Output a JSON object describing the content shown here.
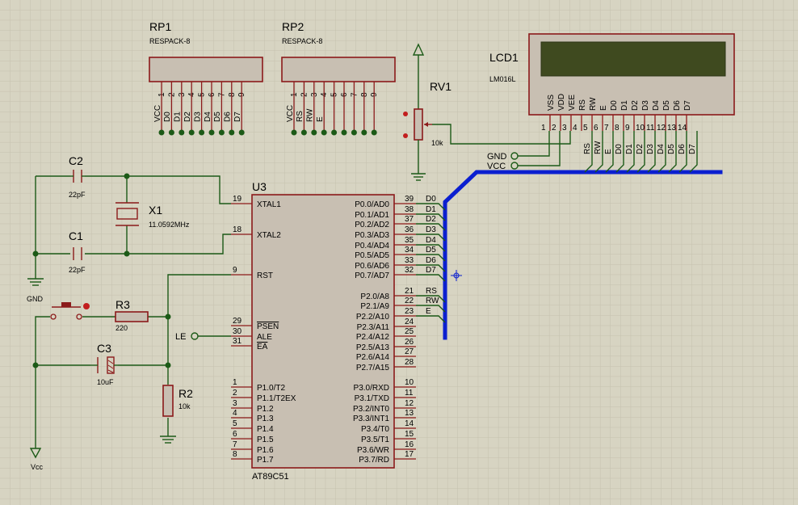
{
  "rp1": {
    "ref": "RP1",
    "value": "RESPACK-8",
    "pins": [
      "VCC",
      "1",
      "D0",
      "2",
      "D1",
      "3",
      "D2",
      "4",
      "D3",
      "5",
      "D4",
      "6",
      "D5",
      "7",
      "D6",
      "8",
      "D7",
      "9"
    ]
  },
  "rp2": {
    "ref": "RP2",
    "value": "RESPACK-8",
    "pins": [
      "VCC",
      "1",
      "RS",
      "2",
      "RW",
      "3",
      "E",
      "4",
      "5",
      "6",
      "7",
      "8",
      "9"
    ]
  },
  "rv1": {
    "ref": "RV1",
    "value": "10k"
  },
  "lcd": {
    "ref": "LCD1",
    "value": "LM016L",
    "pins": [
      "VSS",
      "VDD",
      "VEE",
      "RS",
      "RW",
      "E",
      "D0",
      "D1",
      "D2",
      "D3",
      "D4",
      "D5",
      "D6",
      "D7"
    ],
    "pin_numbers": [
      "1",
      "2",
      "3",
      "4",
      "5",
      "6",
      "7",
      "8",
      "9",
      "10",
      "11",
      "12",
      "13",
      "14"
    ],
    "bus_labels": [
      "RS",
      "RW",
      "E",
      "D0",
      "D1",
      "D2",
      "D3",
      "D4",
      "D5",
      "D6",
      "D7"
    ]
  },
  "terminals": {
    "gnd_right": "GND",
    "vcc_right": "VCC",
    "gnd_left": "GND",
    "vcc_left": "Vcc",
    "le": "LE"
  },
  "c1": {
    "ref": "C1",
    "value": "22pF"
  },
  "c2": {
    "ref": "C2",
    "value": "22pF"
  },
  "c3": {
    "ref": "C3",
    "value": "10uF"
  },
  "x1": {
    "ref": "X1",
    "value": "11.0592MHz"
  },
  "r2": {
    "ref": "R2",
    "value": "10k"
  },
  "r3": {
    "ref": "R3",
    "value": "220"
  },
  "u3": {
    "ref": "U3",
    "part": "AT89C51",
    "left_pins": [
      {
        "num": "19",
        "name": "XTAL1"
      },
      {
        "num": "18",
        "name": "XTAL2"
      },
      {
        "num": "9",
        "name": "RST"
      },
      {
        "num": "29",
        "name": "PSEN"
      },
      {
        "num": "30",
        "name": "ALE"
      },
      {
        "num": "31",
        "name": "EA"
      },
      {
        "num": "1",
        "name": "P1.0/T2"
      },
      {
        "num": "2",
        "name": "P1.1/T2EX"
      },
      {
        "num": "3",
        "name": "P1.2"
      },
      {
        "num": "4",
        "name": "P1.3"
      },
      {
        "num": "5",
        "name": "P1.4"
      },
      {
        "num": "6",
        "name": "P1.5"
      },
      {
        "num": "7",
        "name": "P1.6"
      },
      {
        "num": "8",
        "name": "P1.7"
      }
    ],
    "right_pins": [
      {
        "num": "39",
        "name": "P0.0/AD0",
        "net": "D0"
      },
      {
        "num": "38",
        "name": "P0.1/AD1",
        "net": "D1"
      },
      {
        "num": "37",
        "name": "P0.2/AD2",
        "net": "D2"
      },
      {
        "num": "36",
        "name": "P0.3/AD3",
        "net": "D3"
      },
      {
        "num": "35",
        "name": "P0.4/AD4",
        "net": "D4"
      },
      {
        "num": "34",
        "name": "P0.5/AD5",
        "net": "D5"
      },
      {
        "num": "33",
        "name": "P0.6/AD6",
        "net": "D6"
      },
      {
        "num": "32",
        "name": "P0.7/AD7",
        "net": "D7"
      },
      {
        "num": "21",
        "name": "P2.0/A8",
        "net": "RS"
      },
      {
        "num": "22",
        "name": "P2.1/A9",
        "net": "RW"
      },
      {
        "num": "23",
        "name": "P2.2/A10",
        "net": "E"
      },
      {
        "num": "24",
        "name": "P2.3/A11",
        "net": ""
      },
      {
        "num": "25",
        "name": "P2.4/A12",
        "net": ""
      },
      {
        "num": "26",
        "name": "P2.5/A13",
        "net": ""
      },
      {
        "num": "27",
        "name": "P2.6/A14",
        "net": ""
      },
      {
        "num": "28",
        "name": "P2.7/A15",
        "net": ""
      },
      {
        "num": "10",
        "name": "P3.0/RXD",
        "net": ""
      },
      {
        "num": "11",
        "name": "P3.1/TXD",
        "net": ""
      },
      {
        "num": "12",
        "name": "P3.2/INT0",
        "net": ""
      },
      {
        "num": "13",
        "name": "P3.3/INT1",
        "net": ""
      },
      {
        "num": "14",
        "name": "P3.4/T0",
        "net": ""
      },
      {
        "num": "15",
        "name": "P3.5/T1",
        "net": ""
      },
      {
        "num": "16",
        "name": "P3.6/WR",
        "net": ""
      },
      {
        "num": "17",
        "name": "P3.7/RD",
        "net": ""
      }
    ]
  }
}
